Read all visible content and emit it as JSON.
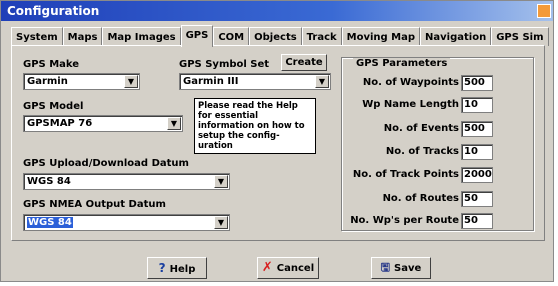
{
  "window": {
    "title": "Configuration"
  },
  "tabs": [
    {
      "label": "System"
    },
    {
      "label": "Maps"
    },
    {
      "label": "Map Images"
    },
    {
      "label": "GPS",
      "active": true
    },
    {
      "label": "COM"
    },
    {
      "label": "Objects"
    },
    {
      "label": "Track"
    },
    {
      "label": "Moving Map"
    },
    {
      "label": "Navigation"
    },
    {
      "label": "GPS Sim"
    }
  ],
  "gps_make": {
    "label": "GPS Make",
    "value": "Garmin"
  },
  "gps_model": {
    "label": "GPS Model",
    "value": "GPSMAP 76"
  },
  "gps_symbol_set": {
    "label": "GPS Symbol Set",
    "value": "Garmin III"
  },
  "create_button": {
    "label": "Create"
  },
  "help_note": "Please read the Help for essential information on how to setup the config-uration",
  "upload_datum": {
    "label": "GPS Upload/Download Datum",
    "value": "WGS 84"
  },
  "nmea_datum": {
    "label": "GPS NMEA Output Datum",
    "value": "WGS 84"
  },
  "gps_parameters": {
    "title": "GPS Parameters",
    "rows": [
      {
        "label": "No. of Waypoints",
        "value": "500"
      },
      {
        "label": "Wp Name Length",
        "value": "10"
      },
      {
        "label": "No. of Events",
        "value": "500"
      },
      {
        "label": "No. of Tracks",
        "value": "10"
      },
      {
        "label": "No. of Track Points",
        "value": "2000"
      },
      {
        "label": "No. of Routes",
        "value": "50"
      },
      {
        "label": "No. Wp's per Route",
        "value": "50"
      }
    ]
  },
  "buttons": {
    "help": "Help",
    "cancel": "Cancel",
    "save": "Save"
  },
  "icons": {
    "help": "question-mark-icon",
    "cancel": "red-x-icon",
    "save": "save-disk-icon"
  },
  "colors": {
    "titlebar": "#1f3fb8",
    "selection": "#2c60d8",
    "dialog_bg": "#d4d0c8"
  }
}
